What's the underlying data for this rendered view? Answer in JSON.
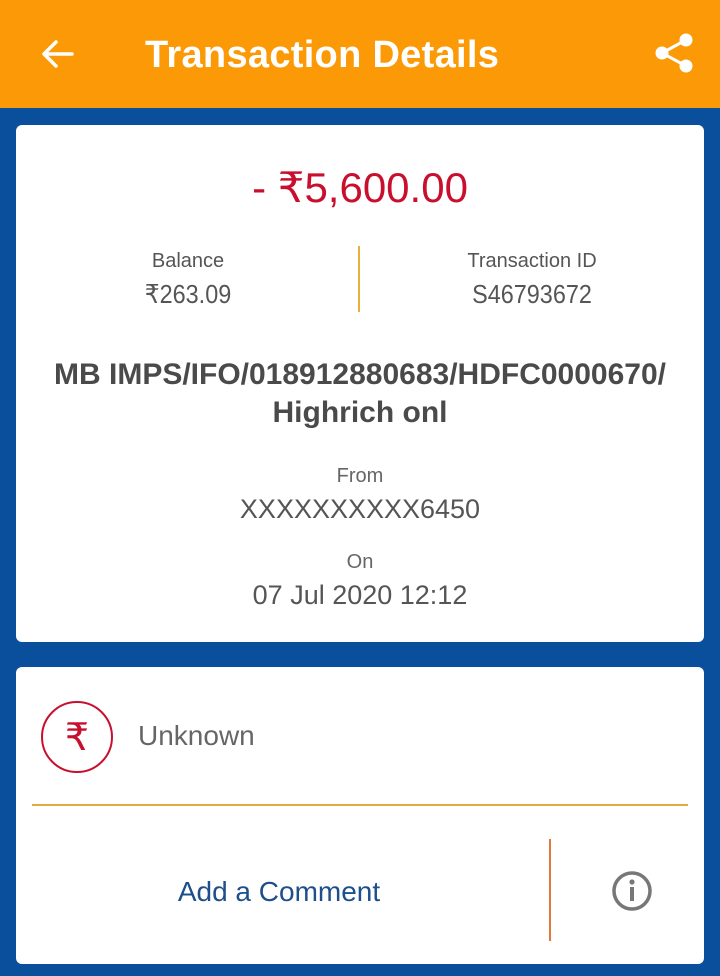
{
  "header": {
    "title": "Transaction Details",
    "back_icon": "arrow-left-icon",
    "share_icon": "share-icon",
    "color": "#fb9a06"
  },
  "transaction": {
    "amount": "- ₹5,600.00",
    "amount_color": "#c8102e",
    "balance_label": "Balance",
    "balance_value": "₹263.09",
    "txn_id_label": "Transaction ID",
    "txn_id_value": "S46793672",
    "description": "MB IMPS/IFO/018912880683/HDFC0000670/ Highrich onl",
    "from_label": "From",
    "from_value": "XXXXXXXXXX6450",
    "on_label": "On",
    "on_value": "07 Jul 2020 12:12"
  },
  "category": {
    "icon": "rupee-icon",
    "icon_glyph": "₹",
    "label": "Unknown"
  },
  "actions": {
    "comment_label": "Add a Comment",
    "info_icon": "info-icon"
  }
}
